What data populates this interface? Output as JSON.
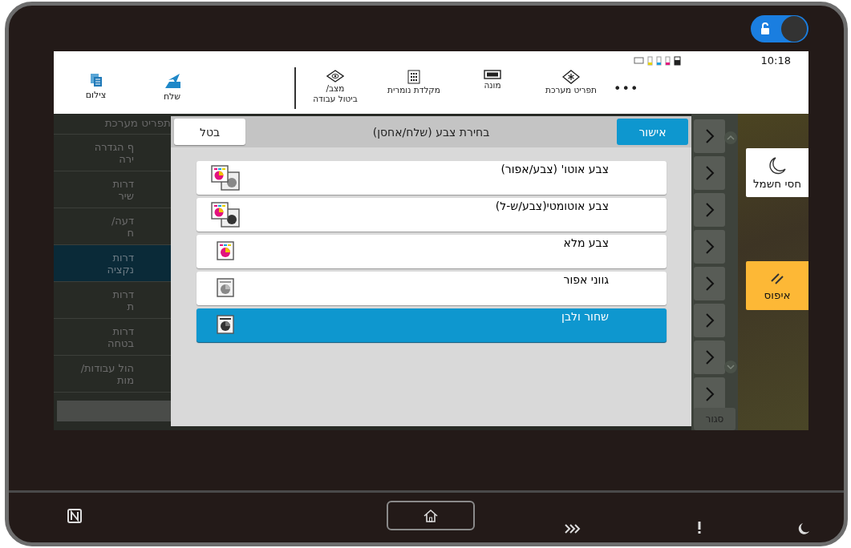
{
  "lock_switch": {
    "on": true
  },
  "top_bar": {
    "time": "10:18",
    "left_items": [
      {
        "label": "שלח"
      },
      {
        "label": "צילום"
      }
    ],
    "tools": [
      {
        "lines": [
          "תפריט מערכת"
        ]
      },
      {
        "lines": [
          "מונה"
        ]
      },
      {
        "lines": [
          "מקלדת נומרית"
        ]
      },
      {
        "lines": [
          "מצב/",
          "ביטול עבודה"
        ]
      }
    ],
    "more": "•••"
  },
  "menu": {
    "title": "תפריט מערכת",
    "items": [
      {
        "lines": [
          "ף הגדרה",
          "ירה"
        ],
        "selected": false
      },
      {
        "lines": [
          "דרות",
          "שיר"
        ],
        "selected": false
      },
      {
        "lines": [
          "דעה/",
          "ח"
        ],
        "selected": false
      },
      {
        "lines": [
          "דרות",
          "נקציה"
        ],
        "selected": true
      },
      {
        "lines": [
          "דרות",
          "ת"
        ],
        "selected": false
      },
      {
        "lines": [
          "דרות",
          "בטחה"
        ],
        "selected": false
      },
      {
        "lines": [
          "הול עבודות/",
          "מות"
        ],
        "selected": false
      }
    ]
  },
  "dialog": {
    "title": "בחירת צבע (שלח/אחסן)",
    "cancel": "בטל",
    "ok": "אישור",
    "options": [
      {
        "label": "צבע אוטו' (צבע/אפור)",
        "kind": "auto-gray",
        "selected": false
      },
      {
        "label": "צבע אוטומטי(צבע/ש-ל)",
        "kind": "auto-bw",
        "selected": false
      },
      {
        "label": "צבע מלא",
        "kind": "color",
        "selected": false
      },
      {
        "label": "גווני אפור",
        "kind": "gray",
        "selected": false
      },
      {
        "label": "שחור ולבן",
        "kind": "bw",
        "selected": true
      }
    ]
  },
  "close_button": "סגור",
  "side_buttons": [
    {
      "label": "חסי חשמל",
      "kind": "sleep"
    },
    {
      "label": "איפוס",
      "kind": "reset"
    }
  ]
}
